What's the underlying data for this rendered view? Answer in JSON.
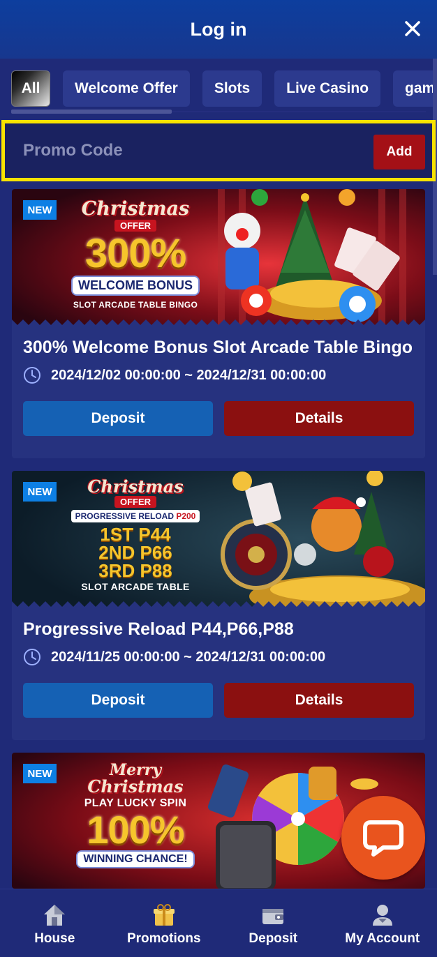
{
  "header": {
    "title": "Log in",
    "close_icon": "close-icon"
  },
  "tabs": [
    {
      "label": "All",
      "active": true
    },
    {
      "label": "Welcome Offer"
    },
    {
      "label": "Slots"
    },
    {
      "label": "Live Casino"
    },
    {
      "label": "game"
    }
  ],
  "promo": {
    "placeholder": "Promo Code",
    "add_label": "Add"
  },
  "promotions": [
    {
      "badge": "NEW",
      "banner": {
        "script": "Christmas",
        "offer": "OFFER",
        "big": "300%",
        "pill": "WELCOME BONUS",
        "small": "SLOT ARCADE TABLE BINGO"
      },
      "title": "300% Welcome Bonus Slot Arcade Table Bingo",
      "date": "2024/12/02 00:00:00 ~ 2024/12/31 00:00:00",
      "deposit_label": "Deposit",
      "details_label": "Details"
    },
    {
      "badge": "NEW",
      "banner": {
        "script": "Christmas",
        "offer": "OFFER",
        "prog": "PROGRESSIVE RELOAD",
        "prog_amount": "P200",
        "line1": "1ST P44",
        "line2": "2ND P66",
        "line3": "3RD P88",
        "small": "SLOT ARCADE TABLE"
      },
      "title": "Progressive Reload P44,P66,P88",
      "date": "2024/11/25 00:00:00 ~ 2024/12/31 00:00:00",
      "deposit_label": "Deposit",
      "details_label": "Details"
    },
    {
      "badge": "NEW",
      "banner": {
        "script1": "Merry",
        "script2": "Christmas",
        "line": "PLAY LUCKY SPIN",
        "big": "100%",
        "pill": "WINNING CHANCE!"
      }
    }
  ],
  "bottom_nav": [
    {
      "label": "House",
      "icon": "house-icon"
    },
    {
      "label": "Promotions",
      "icon": "gift-icon"
    },
    {
      "label": "Deposit",
      "icon": "wallet-icon"
    },
    {
      "label": "My Account",
      "icon": "user-icon"
    }
  ],
  "colors": {
    "accent_yellow": "#f8e300",
    "deposit_blue": "#1561b4",
    "details_red": "#8b1010",
    "chat_orange": "#e9541e"
  }
}
